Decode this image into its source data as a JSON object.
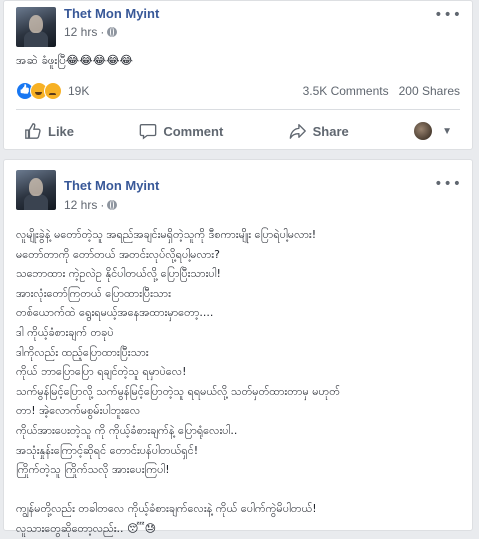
{
  "posts": [
    {
      "author": "Thet Mon Myint",
      "time": "12 hrs",
      "text": "အဆဲ ခံဖူးပြီ😂😂😂😂😂",
      "reactions_count": "19K",
      "comments": "3.5K Comments",
      "shares": "200 Shares",
      "actions": {
        "like": "Like",
        "comment": "Comment",
        "share": "Share"
      }
    },
    {
      "author": "Thet Mon Myint",
      "time": "12 hrs",
      "text": "လူမျိုးခွဲနဲ့ မတော်တဲ့သူ အရည်အချင်းမရှိတဲ့သူကို ဒီစကားမျိုး ပြောရဲပါ့မလား!\nမတော်တာကို တော်တယ် အတင်းလုပ်လို့ရပါ့မလား?\nသဘောထား ကဲ့ဥလဲဥ နိုင်ပါတယ်လို့ ပြောပြီးသားပါ!\nအားလုံးတော်ကြတယ် ပြောထားပြီးသား\nတစ်ယောက်ထဲ ရွေးရမယ့်အနေအထားမှာတော့....\nဒါ ကိုယ့်ခံစားချက် တခုပဲ\nဒါကိုလည်း ထည့်ပြောထားပြီးသား\nကိုယ် ဘာပြောပြော ရချင်တဲ့သူ ရမှာပဲလေ!\nသက်မွန်မြင့်ပြောလို့ သက်မွန်မြင့်ပြောတဲ့သူ ရရမယ်လို့ သတ်မှတ်ထားတာမှ မဟုတ်\nတာ! အဲ့လောက်မစွမ်းပါဘူးလေ\nကိုယ်အားပေးတဲ့သူ ကို ကိုယ့်ခံစားချက်နဲ့ ပြောရုံလေးပါ..\nအသုံးနှုန်းကြောင့်ဆိုရင် တောင်းပန်ပါတယ်ရှင်!\nကြိုက်တဲ့သူ ကြိုက်သလို အားပေးကြပါ!\n\nကျွန်မတို့လည်း တခါတလေ ကိုယ့်ခံစားချက်လေးနဲ့ ကိုယ် ပေါက်ကွဲမိပါတယ်!\nလူသားတွေဆိုတော့လည်း.. 😴😓"
    }
  ],
  "icons": {
    "globe": "globe-icon",
    "more": "more-options-icon",
    "like": "thumbs-up-icon",
    "comment": "comment-bubble-icon",
    "share": "share-arrow-icon"
  },
  "colors": {
    "name": "#385898",
    "like_reaction": "#1877f2",
    "haha_reaction": "#f7b125"
  },
  "ui": {
    "more_glyph": "•••",
    "time_separator": "·"
  }
}
